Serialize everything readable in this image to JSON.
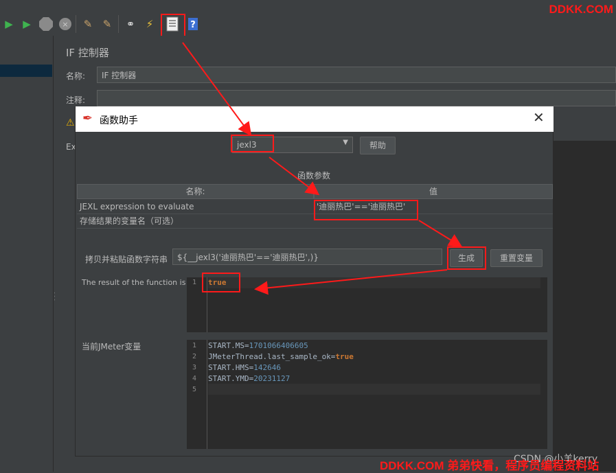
{
  "brand": {
    "top": "DDKK.COM",
    "bottom": "DDKK.COM 弟弟快看，程序员编程资料站",
    "csdn": "CSDN @小羊kerry"
  },
  "toolbar": {
    "icons": [
      "run-icon",
      "run-no-pause-icon",
      "stop-icon",
      "shutdown-icon",
      "clear-icon",
      "clear-all-icon",
      "search-binoculars-icon",
      "reset-broom-icon",
      "function-helper-icon",
      "help-icon"
    ]
  },
  "panel": {
    "title": "IF 控制器",
    "name_label": "名称:",
    "name_value": "IF 控制器",
    "comment_label": "注释:",
    "ex_label": "Ex"
  },
  "dialog": {
    "title": "函数助手",
    "function_select": "jexl3",
    "help_button": "帮助",
    "params_title": "函数参数",
    "table": {
      "headers": [
        "名称:",
        "值"
      ],
      "rows": [
        {
          "name": "JEXL expression to evaluate",
          "value": "'迪丽热巴'=='迪丽热巴'"
        },
        {
          "name": "存储结果的变量名（可选）",
          "value": ""
        }
      ]
    },
    "copy_label": "拷贝并粘贴函数字符串",
    "copy_value": "${__jexl3('迪丽热巴'=='迪丽热巴',)}",
    "generate_button": "生成",
    "reset_button": "重置变量",
    "result_label": "The result of the function is",
    "result_lines": [
      {
        "n": "1",
        "text": "true"
      }
    ],
    "vars_label": "当前JMeter变量",
    "var_lines": [
      {
        "n": "1",
        "key": "START.MS=",
        "val": "1701066406605"
      },
      {
        "n": "2",
        "key": "JMeterThread.last_sample_ok=",
        "val": "true"
      },
      {
        "n": "3",
        "key": "START.HMS=",
        "val": "142646"
      },
      {
        "n": "4",
        "key": "START.YMD=",
        "val": "20231127"
      },
      {
        "n": "5",
        "key": "",
        "val": ""
      }
    ]
  },
  "colors": {
    "annotation": "#ff1a1a",
    "keyword": "#cc7832",
    "number": "#6897bb",
    "selection": "#0d293e"
  }
}
